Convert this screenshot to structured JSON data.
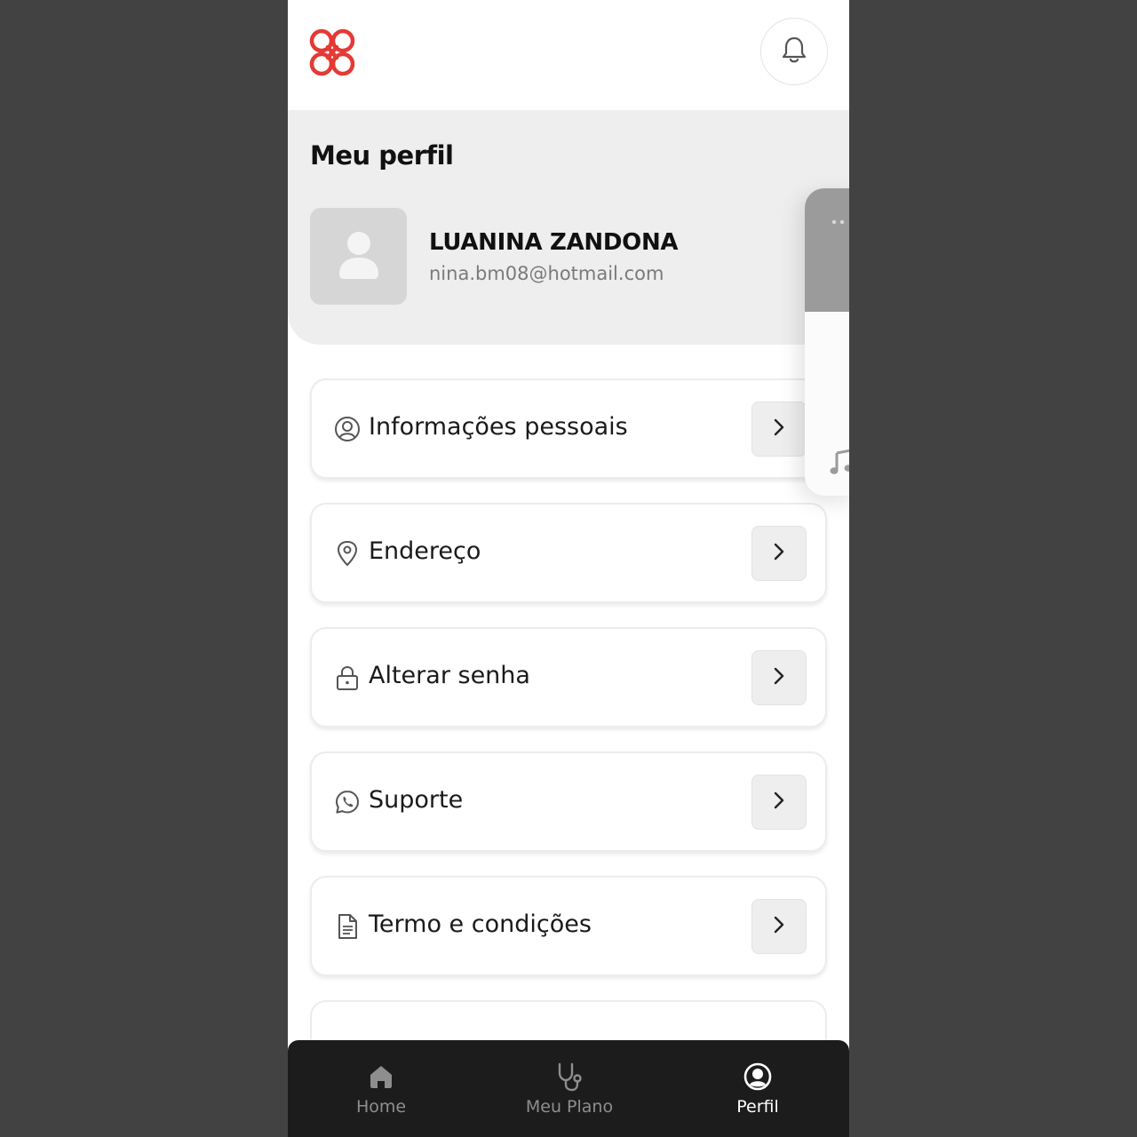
{
  "header": {
    "logo_icon": "brand-logo-icon",
    "notification_icon": "bell-icon"
  },
  "profile": {
    "page_title": "Meu perfil",
    "name": "LUANINA ZANDONA",
    "email": "nina.bm08@hotmail.com",
    "avatar_icon": "user-placeholder-icon"
  },
  "menu": {
    "items": [
      {
        "label": "Informações pessoais",
        "icon": "user-circle-icon"
      },
      {
        "label": "Endereço",
        "icon": "location-pin-icon"
      },
      {
        "label": "Alterar senha",
        "icon": "lock-icon"
      },
      {
        "label": "Suporte",
        "icon": "whatsapp-icon"
      },
      {
        "label": "Termo e condições",
        "icon": "document-icon"
      }
    ]
  },
  "bottom_nav": {
    "items": [
      {
        "label": "Home",
        "icon": "home-icon",
        "active": false
      },
      {
        "label": "Meu Plano",
        "icon": "stethoscope-icon",
        "active": false
      },
      {
        "label": "Perfil",
        "icon": "profile-icon",
        "active": true
      }
    ]
  },
  "colors": {
    "brand": "#e53935",
    "background": "#424242",
    "panel": "#eeeeee",
    "nav_background": "#1c1c1c",
    "nav_active": "#ffffff",
    "nav_inactive": "#8e8e8e"
  }
}
